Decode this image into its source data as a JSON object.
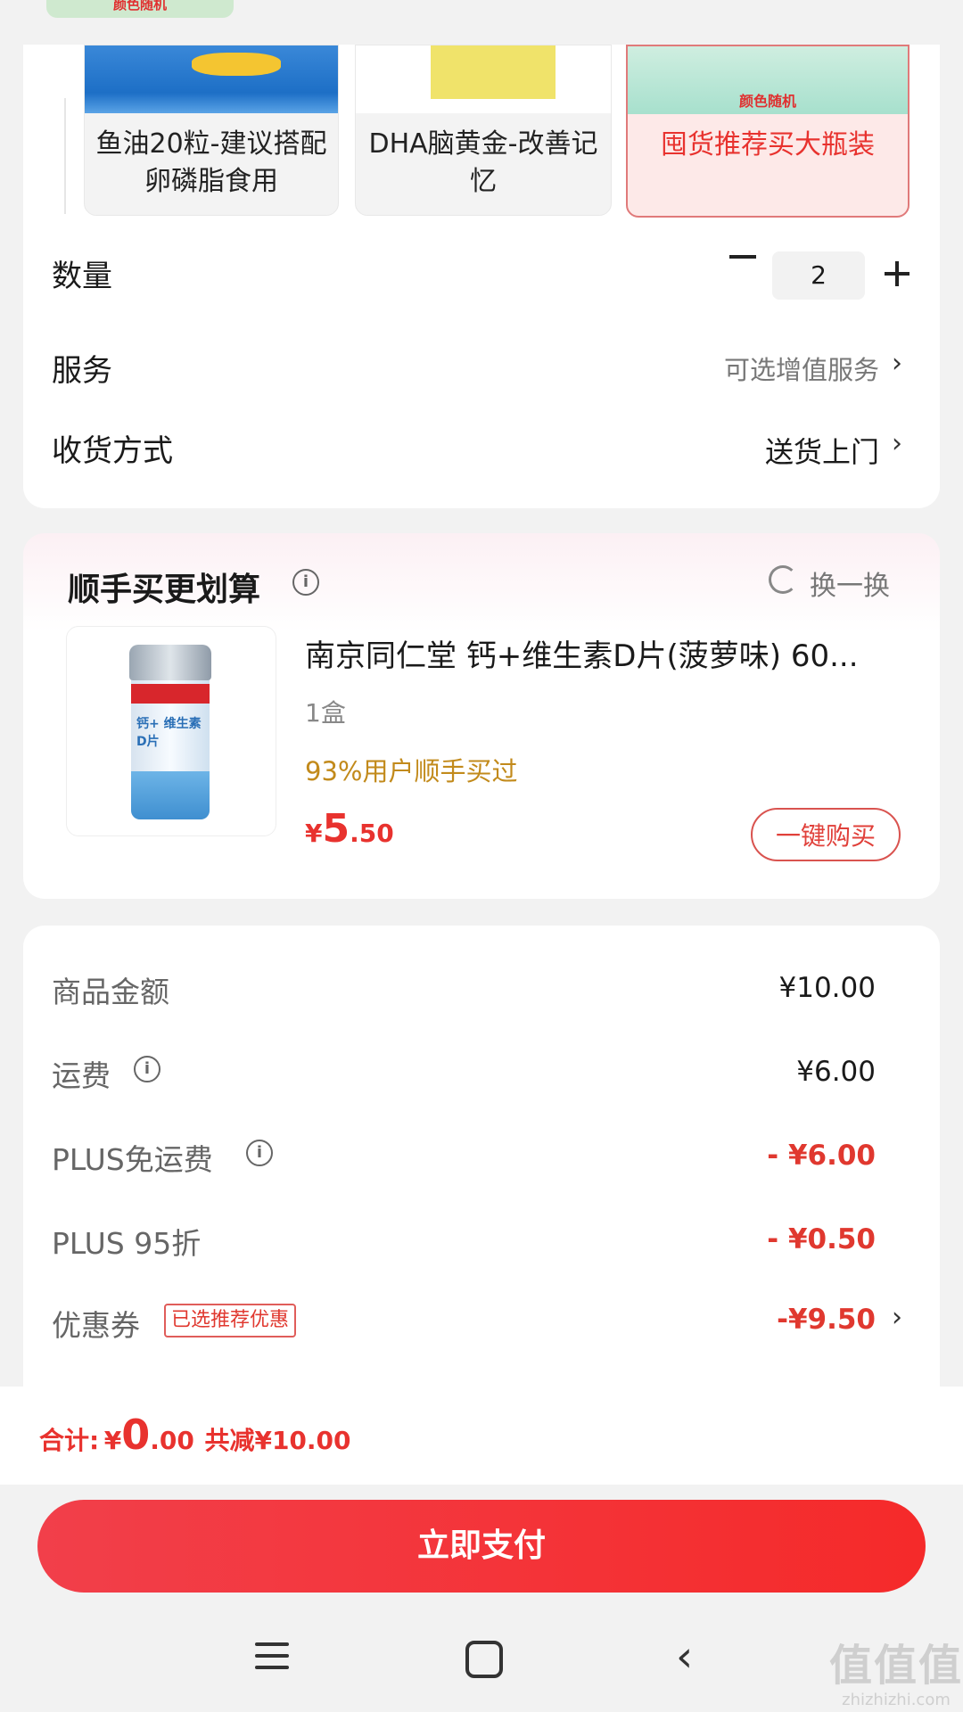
{
  "top_tag": "颜色随机",
  "options": [
    {
      "label": "鱼油20粒-建议搭配卵磷脂食用",
      "selected": false
    },
    {
      "label": "DHA脑黄金-改善记忆",
      "selected": false
    },
    {
      "label": "囤货推荐买大瓶装",
      "caption": "颜色随机",
      "selected": true
    }
  ],
  "quantity": {
    "label": "数量",
    "value": "2"
  },
  "service": {
    "label": "服务",
    "value": "可选增值服务"
  },
  "delivery": {
    "label": "收货方式",
    "value": "送货上门"
  },
  "addon": {
    "title": "顺手买更划算",
    "refresh": "换一换",
    "product_name": "南京同仁堂 钙+维生素D片(菠萝味) 60...",
    "bottle_text": "钙+ 维生素D片",
    "spec": "1盒",
    "bought": "93%用户顺手买过",
    "price_symbol": "¥",
    "price_int": "5",
    "price_dec": ".50",
    "buy_button": "一键购买"
  },
  "summary": {
    "goods": {
      "label": "商品金额",
      "value": "¥10.00"
    },
    "shipping": {
      "label": "运费",
      "value": "¥6.00"
    },
    "plus_free_ship": {
      "label": "PLUS免运费",
      "value": "- ¥6.00"
    },
    "plus_discount": {
      "label": "PLUS 95折",
      "value": "- ¥0.50"
    },
    "coupon": {
      "label": "优惠券",
      "badge": "已选推荐优惠",
      "value": "-¥9.50"
    }
  },
  "total": {
    "label": "合计:",
    "symbol": "¥",
    "int": "0",
    "dec": ".00",
    "saved": "共减¥10.00"
  },
  "pay_button": "立即支付",
  "watermark": {
    "big": "值值值",
    "small": "zhizhizhi.com"
  },
  "colors": {
    "accent": "#e8322e",
    "gold": "#c28a1b"
  }
}
